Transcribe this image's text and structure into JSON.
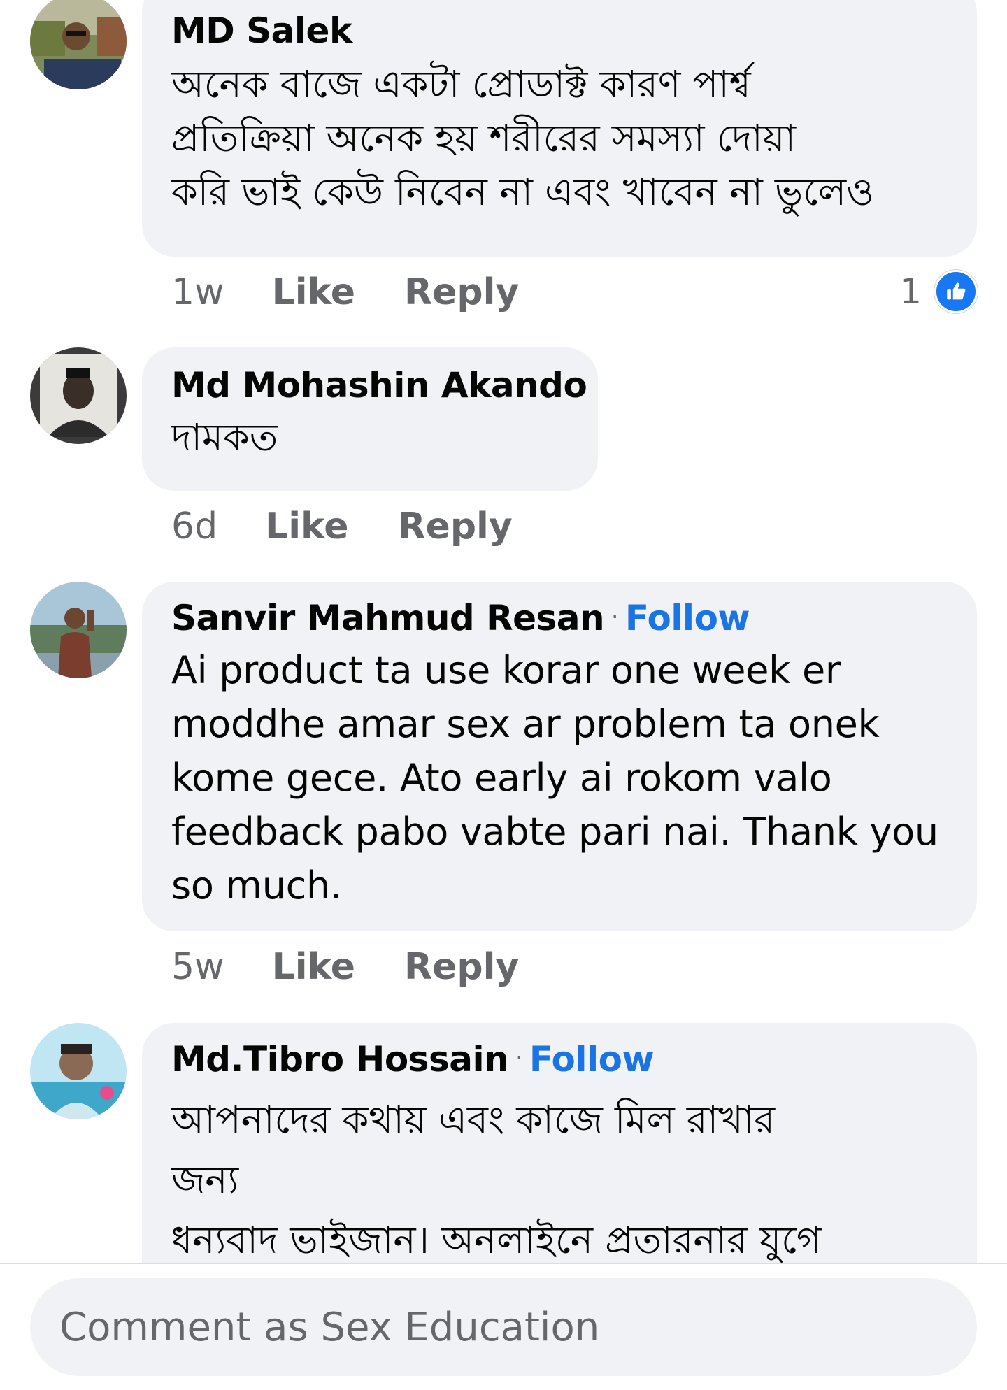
{
  "comments": [
    {
      "author": "MD Salek",
      "follow": "",
      "lines": [
        "অনেক বাজে একটা প্রোডাক্ট কারণ পার্শ্ব",
        "প্রতিক্রিয়া অনেক হয় শরীরের সমস্যা দোয়া",
        "করি ভাই কেউ নিবেন না এবং খাবেন না ভুলেও"
      ],
      "time": "1w",
      "like_label": "Like",
      "reply_label": "Reply",
      "reaction_count": "1"
    },
    {
      "author": "Md Mohashin Akando",
      "follow": "",
      "lines": [
        "দামকত"
      ],
      "time": "6d",
      "like_label": "Like",
      "reply_label": "Reply"
    },
    {
      "author": "Sanvir Mahmud Resan",
      "follow": "Follow",
      "lines": [
        "Ai product ta use korar one week er",
        "moddhe amar sex ar problem ta onek",
        "kome gece. Ato early ai rokom valo",
        "feedback pabo vabte pari nai. Thank you",
        "so much."
      ],
      "time": "5w",
      "like_label": "Like",
      "reply_label": "Reply"
    },
    {
      "author": "Md.Tibro Hossain",
      "follow": "Follow",
      "lines": [
        "আপনাদের কথায় এবং কাজে মিল রাখার",
        "জন্য",
        "ধন্যবাদ ভাইজান। অনলাইনে প্রতারনার যুগে"
      ]
    }
  ],
  "separator": "·",
  "composer": {
    "placeholder": "Comment as Sex Education"
  },
  "colors": {
    "bubble": "#f0f2f5",
    "follow": "#1b74e4",
    "secondary_text": "#65676b",
    "like_badge": "#1877f2"
  },
  "icons": {
    "reaction": "like-thumbs-up-icon"
  }
}
